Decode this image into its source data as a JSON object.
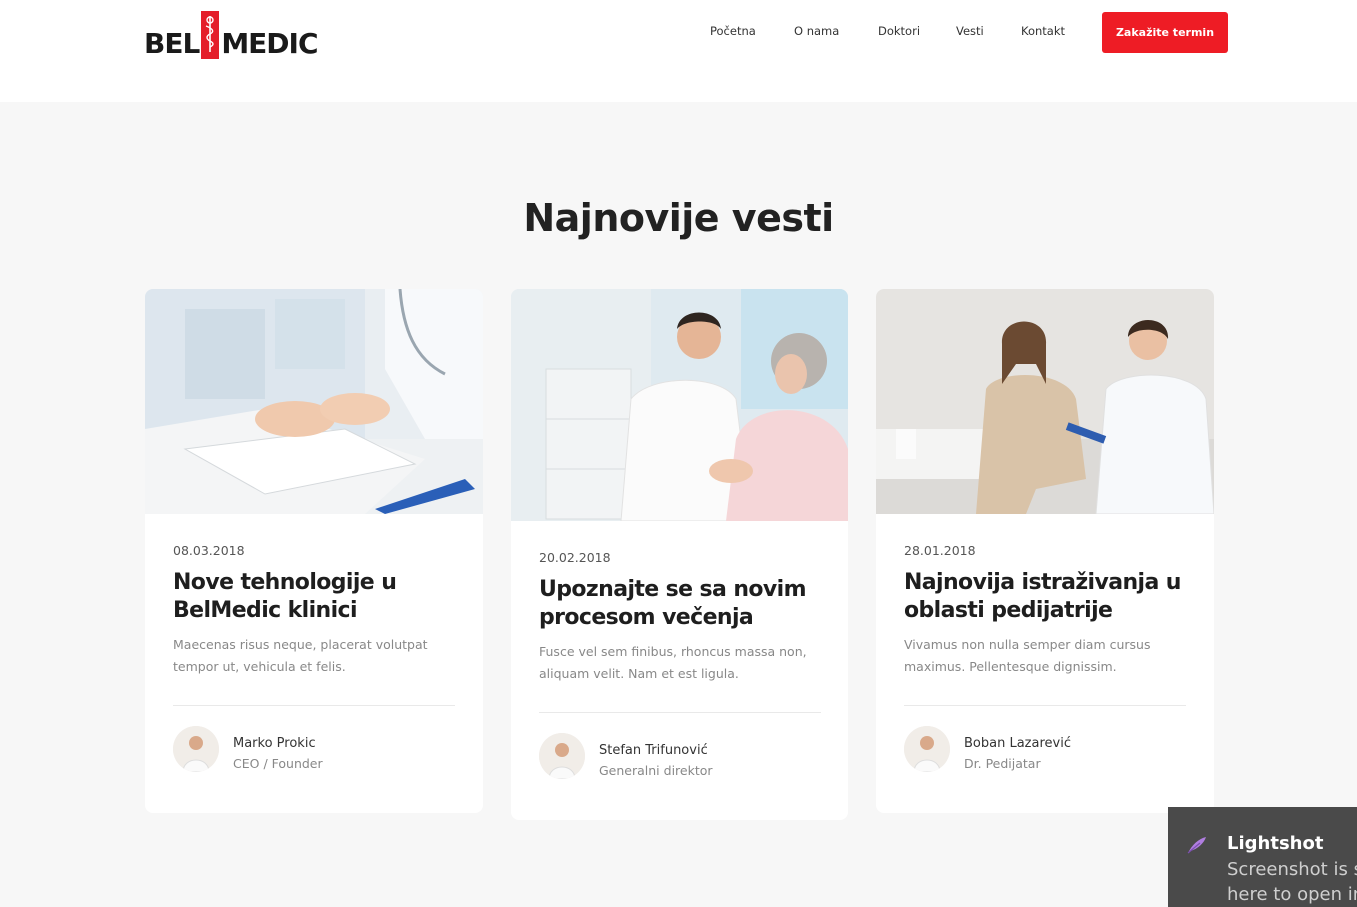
{
  "header": {
    "logo_left": "BEL",
    "logo_right": "MEDIC",
    "nav": [
      "Početna",
      "O nama",
      "Doktori",
      "Vesti",
      "Kontakt"
    ],
    "cta_label": "Zakažite termin",
    "brand_color": "#ee1c25"
  },
  "news": {
    "title": "Najnovije vesti",
    "cards": [
      {
        "date": "08.03.2018",
        "title": "Nove tehnologije u BelMedic klinici",
        "excerpt": "Maecenas risus neque, placerat volutpat tempor ut, vehicula et felis.",
        "author": "Marko Prokic",
        "role": "CEO / Founder"
      },
      {
        "date": "20.02.2018",
        "title": "Upoznajte se sa novim procesom večenja",
        "excerpt": "Fusce vel sem finibus, rhoncus massa non, aliquam velit. Nam et est ligula.",
        "author": "Stefan Trifunović",
        "role": "Generalni direktor"
      },
      {
        "date": "28.01.2018",
        "title": "Najnovija istraživanja u oblasti pedijatrije",
        "excerpt": "Vivamus non nulla semper diam cursus maximus. Pellentesque dignissim.",
        "author": "Boban Lazarević",
        "role": "Dr. Pedijatar"
      }
    ]
  },
  "toast": {
    "title": "Lightshot",
    "line1": "Screenshot is sa",
    "line2": "here to open in"
  }
}
